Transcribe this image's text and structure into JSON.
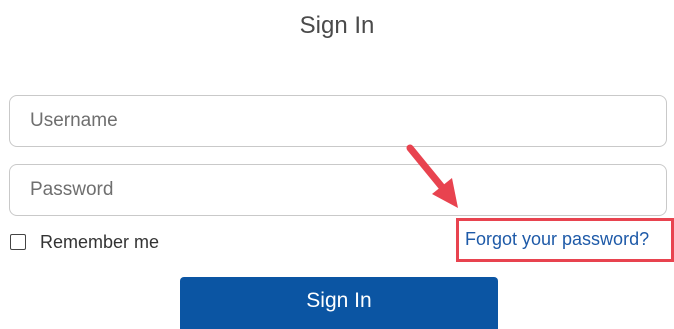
{
  "header": {
    "title": "Sign In"
  },
  "form": {
    "username_placeholder": "Username",
    "username_value": "",
    "password_placeholder": "Password",
    "password_value": "",
    "remember_label": "Remember me",
    "remember_checked": false,
    "forgot_link": "Forgot your password?",
    "submit_label": "Sign In"
  },
  "annotations": {
    "arrow_icon": "red-arrow-icon",
    "highlight_color": "#e8434f"
  },
  "colors": {
    "button": "#0b55a3",
    "link": "#1e5aa8"
  }
}
